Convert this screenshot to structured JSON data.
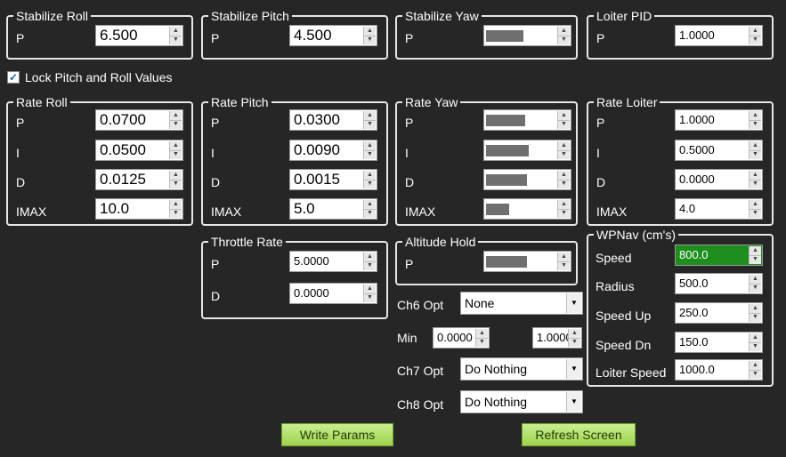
{
  "stabilize_roll": {
    "title": "Stabilize Roll",
    "p_label": "P",
    "p": "6.500"
  },
  "stabilize_pitch": {
    "title": "Stabilize Pitch",
    "p_label": "P",
    "p": "4.500"
  },
  "stabilize_yaw": {
    "title": "Stabilize Yaw",
    "p_label": "P"
  },
  "loiter_pid": {
    "title": "Loiter PID",
    "p_label": "P",
    "p": "1.0000"
  },
  "lock_pitch_roll": {
    "label": "Lock Pitch and Roll Values",
    "checked": true
  },
  "rate_roll": {
    "title": "Rate Roll",
    "p_label": "P",
    "i_label": "I",
    "d_label": "D",
    "imax_label": "IMAX",
    "p": "0.0700",
    "i": "0.0500",
    "d": "0.0125",
    "imax": "10.0"
  },
  "rate_pitch": {
    "title": "Rate Pitch",
    "p_label": "P",
    "i_label": "I",
    "d_label": "D",
    "imax_label": "IMAX",
    "p": "0.0300",
    "i": "0.0090",
    "d": "0.0015",
    "imax": "5.0"
  },
  "rate_yaw": {
    "title": "Rate Yaw",
    "p_label": "P",
    "i_label": "I",
    "d_label": "D",
    "imax_label": "IMAX"
  },
  "rate_loiter": {
    "title": "Rate Loiter",
    "p_label": "P",
    "i_label": "I",
    "d_label": "D",
    "imax_label": "IMAX",
    "p": "1.0000",
    "i": "0.5000",
    "d": "0.0000",
    "imax": "4.0"
  },
  "throttle_rate": {
    "title": "Throttle Rate",
    "p_label": "P",
    "d_label": "D",
    "p": "5.0000",
    "d": "0.0000"
  },
  "altitude_hold": {
    "title": "Altitude Hold",
    "p_label": "P"
  },
  "wpnav": {
    "title": "WPNav (cm's)",
    "speed_label": "Speed",
    "speed": "800.0",
    "radius_label": "Radius",
    "radius": "500.0",
    "speed_up_label": "Speed Up",
    "speed_up": "250.0",
    "speed_dn_label": "Speed Dn",
    "speed_dn": "150.0",
    "loiter_speed_label": "Loiter Speed",
    "loiter_speed": "1000.0"
  },
  "ch6": {
    "label": "Ch6 Opt",
    "value": "None"
  },
  "ch6_range": {
    "min_label": "Min",
    "min": "0.0000",
    "max": "1.0000"
  },
  "ch7": {
    "label": "Ch7 Opt",
    "value": "Do Nothing"
  },
  "ch8": {
    "label": "Ch8 Opt",
    "value": "Do Nothing"
  },
  "buttons": {
    "write": "Write Params",
    "refresh": "Refresh Screen"
  },
  "colors": {
    "background": "#262626",
    "highlight_field": "#1e8f1e",
    "button": "#b5e26b"
  }
}
